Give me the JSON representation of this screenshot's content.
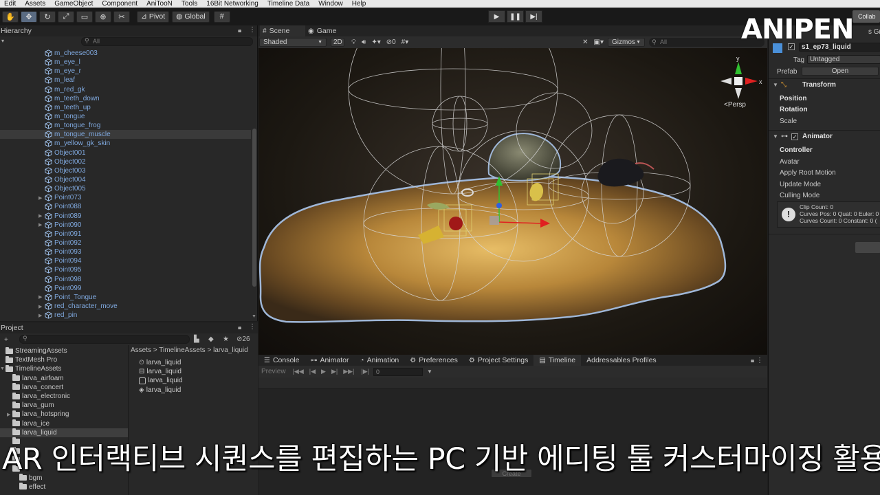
{
  "menu": [
    "Edit",
    "Assets",
    "GameObject",
    "Component",
    "AniTooN",
    "Tools",
    "16Bit Networking",
    "Timeline Data",
    "Window",
    "Help"
  ],
  "toolbar": {
    "pivot": "Pivot",
    "global": "Global",
    "collab": "Collab"
  },
  "hierarchy": {
    "title": "Hierarchy",
    "search_placeholder": "All",
    "items": [
      {
        "label": "m_cheese003",
        "arrow": false
      },
      {
        "label": "m_eye_l",
        "arrow": false
      },
      {
        "label": "m_eye_r",
        "arrow": false
      },
      {
        "label": "m_leaf",
        "arrow": false
      },
      {
        "label": "m_red_gk",
        "arrow": false
      },
      {
        "label": "m_teeth_down",
        "arrow": false
      },
      {
        "label": "m_teeth_up",
        "arrow": false
      },
      {
        "label": "m_tongue",
        "arrow": false
      },
      {
        "label": "m_tongue_frog",
        "arrow": false
      },
      {
        "label": "m_tongue_muscle",
        "arrow": false
      },
      {
        "label": "m_yellow_gk_skin",
        "arrow": false
      },
      {
        "label": "Object001",
        "arrow": false
      },
      {
        "label": "Object002",
        "arrow": false
      },
      {
        "label": "Object003",
        "arrow": false
      },
      {
        "label": "Object004",
        "arrow": false
      },
      {
        "label": "Object005",
        "arrow": false
      },
      {
        "label": "Point073",
        "arrow": true
      },
      {
        "label": "Point088",
        "arrow": false
      },
      {
        "label": "Point089",
        "arrow": true
      },
      {
        "label": "Point090",
        "arrow": true
      },
      {
        "label": "Point091",
        "arrow": false
      },
      {
        "label": "Point092",
        "arrow": false
      },
      {
        "label": "Point093",
        "arrow": false
      },
      {
        "label": "Point094",
        "arrow": false
      },
      {
        "label": "Point095",
        "arrow": false
      },
      {
        "label": "Point098",
        "arrow": false
      },
      {
        "label": "Point099",
        "arrow": false
      },
      {
        "label": "Point_Tongue",
        "arrow": true
      },
      {
        "label": "red_character_move",
        "arrow": true
      },
      {
        "label": "red_pin",
        "arrow": true
      }
    ]
  },
  "project": {
    "title": "Project",
    "hidden_count": "26",
    "tree": [
      {
        "label": "StreamingAssets",
        "indent": 1
      },
      {
        "label": "TextMesh Pro",
        "indent": 1
      },
      {
        "label": "TimelineAssets",
        "indent": 1
      },
      {
        "label": "larva_airfoam",
        "indent": 2
      },
      {
        "label": "larva_concert",
        "indent": 2
      },
      {
        "label": "larva_electronic",
        "indent": 2
      },
      {
        "label": "larva_gum",
        "indent": 2
      },
      {
        "label": "larva_hotspring",
        "indent": 2
      },
      {
        "label": "larva_ice",
        "indent": 2
      },
      {
        "label": "larva_liquid",
        "indent": 2
      },
      {
        "label": "",
        "indent": 2
      },
      {
        "label": "",
        "indent": 2
      },
      {
        "label": "",
        "indent": 2
      },
      {
        "label": "",
        "indent": 2
      },
      {
        "label": "bgm",
        "indent": 3
      },
      {
        "label": "effect",
        "indent": 3
      }
    ],
    "breadcrumb": [
      "Assets",
      "TimelineAssets",
      "larva_liquid"
    ],
    "assets": [
      "larva_liquid",
      "larva_liquid",
      "larva_liquid",
      "larva_liquid"
    ]
  },
  "scene": {
    "tab_scene": "Scene",
    "tab_game": "Game",
    "shading": "Shaded",
    "mode_2d": "2D",
    "fx_count": "0",
    "gizmos": "Gizmos",
    "search_placeholder": "All",
    "persp": "<Persp"
  },
  "bottom": {
    "tabs": [
      "Console",
      "Animator",
      "Animation",
      "Preferences",
      "Project Settings",
      "Timeline",
      "Addressables Profiles"
    ],
    "preview": "Preview",
    "frame": "0",
    "create": "Create"
  },
  "inspector": {
    "object_name": "s1_ep73_liquid",
    "tag_label": "Tag",
    "tag_value": "Untagged",
    "prefab_label": "Prefab",
    "prefab_open": "Open",
    "transform": "Transform",
    "position": "Position",
    "rotation": "Rotation",
    "scale": "Scale",
    "animator": "Animator",
    "controller": "Controller",
    "avatar": "Avatar",
    "apply_root_motion": "Apply Root Motion",
    "update_mode": "Update Mode",
    "culling_mode": "Culling Mode",
    "info_lines": [
      "Clip Count: 0",
      "Curves Pos: 0 Quat: 0 Euler: 0",
      "Curves Count: 0 Constant: 0 ("
    ],
    "top_right": "s Gro"
  },
  "watermark": "ANIPEN",
  "subtitle": "AR 인터랙티브 시퀀스를 편집하는 PC 기반 에디팅 툴 커스터마이징 활용"
}
